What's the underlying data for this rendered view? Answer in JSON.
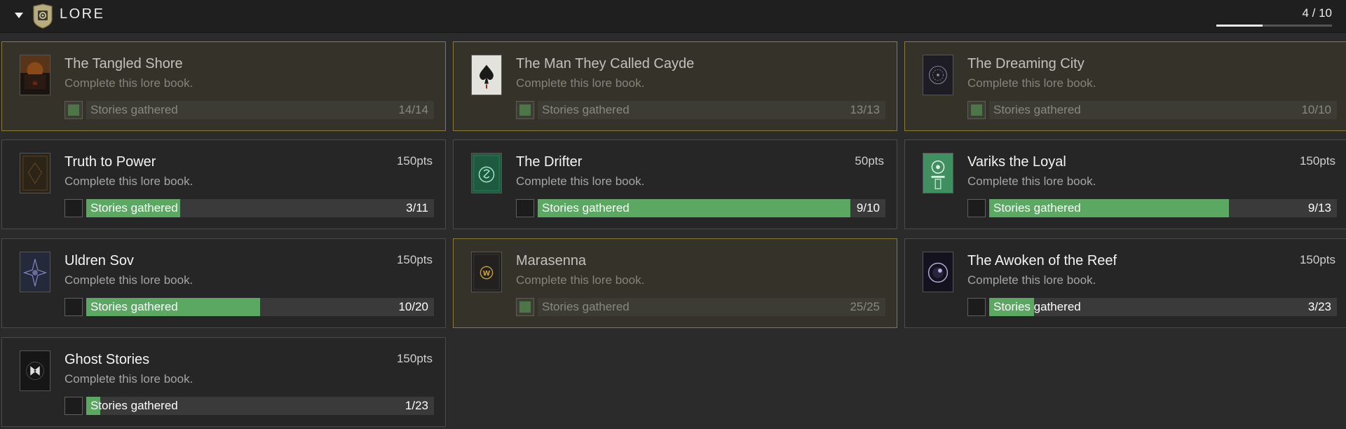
{
  "section": {
    "title": "LORE",
    "progress_text": "4 / 10",
    "progress_fraction": 0.4
  },
  "cards": [
    {
      "name": "The Tangled Shore",
      "description": "Complete this lore book.",
      "points": "",
      "objective": "Stories gathered",
      "count": "14/14",
      "fraction": 1.0,
      "completed": true,
      "icon": "tangled-shore-book-icon",
      "icon_colors": [
        "#1a1410",
        "#c03a1a"
      ]
    },
    {
      "name": "The Man They Called Cayde",
      "description": "Complete this lore book.",
      "points": "",
      "objective": "Stories gathered",
      "count": "13/13",
      "fraction": 1.0,
      "completed": true,
      "icon": "cayde-ace-of-spades-book-icon",
      "icon_colors": [
        "#e4e2dc",
        "#1a1a1a"
      ]
    },
    {
      "name": "The Dreaming City",
      "description": "Complete this lore book.",
      "points": "",
      "objective": "Stories gathered",
      "count": "10/10",
      "fraction": 1.0,
      "completed": true,
      "icon": "dreaming-city-book-icon",
      "icon_colors": [
        "#1e1d26",
        "#8c8aa0"
      ]
    },
    {
      "name": "Truth to Power",
      "description": "Complete this lore book.",
      "points": "150pts",
      "objective": "Stories gathered",
      "count": "3/11",
      "fraction": 0.27,
      "completed": false,
      "icon": "truth-to-power-book-icon",
      "icon_colors": [
        "#2d2418",
        "#5a4426"
      ]
    },
    {
      "name": "The Drifter",
      "description": "Complete this lore book.",
      "points": "50pts",
      "objective": "Stories gathered",
      "count": "9/10",
      "fraction": 0.9,
      "completed": false,
      "icon": "drifter-book-icon",
      "icon_colors": [
        "#1d5a40",
        "#9fe0c4"
      ]
    },
    {
      "name": "Variks the Loyal",
      "description": "Complete this lore book.",
      "points": "150pts",
      "objective": "Stories gathered",
      "count": "9/13",
      "fraction": 0.69,
      "completed": false,
      "icon": "variks-book-icon",
      "icon_colors": [
        "#3f8f60",
        "#e0f0e4"
      ]
    },
    {
      "name": "Uldren Sov",
      "description": "Complete this lore book.",
      "points": "150pts",
      "objective": "Stories gathered",
      "count": "10/20",
      "fraction": 0.5,
      "completed": false,
      "icon": "uldren-sov-book-icon",
      "icon_colors": [
        "#252a3a",
        "#8a88c8"
      ]
    },
    {
      "name": "Marasenna",
      "description": "Complete this lore book.",
      "points": "",
      "objective": "Stories gathered",
      "count": "25/25",
      "fraction": 1.0,
      "completed": true,
      "icon": "marasenna-book-icon",
      "icon_colors": [
        "#22211f",
        "#c9a23a"
      ]
    },
    {
      "name": "The Awoken of the Reef",
      "description": "Complete this lore book.",
      "points": "150pts",
      "objective": "Stories gathered",
      "count": "3/23",
      "fraction": 0.13,
      "completed": false,
      "icon": "awoken-reef-book-icon",
      "icon_colors": [
        "#14121f",
        "#b9b4e0"
      ]
    },
    {
      "name": "Ghost Stories",
      "description": "Complete this lore book.",
      "points": "150pts",
      "objective": "Stories gathered",
      "count": "1/23",
      "fraction": 0.04,
      "completed": false,
      "icon": "ghost-stories-book-icon",
      "icon_colors": [
        "#161616",
        "#e0e0e0"
      ]
    }
  ]
}
